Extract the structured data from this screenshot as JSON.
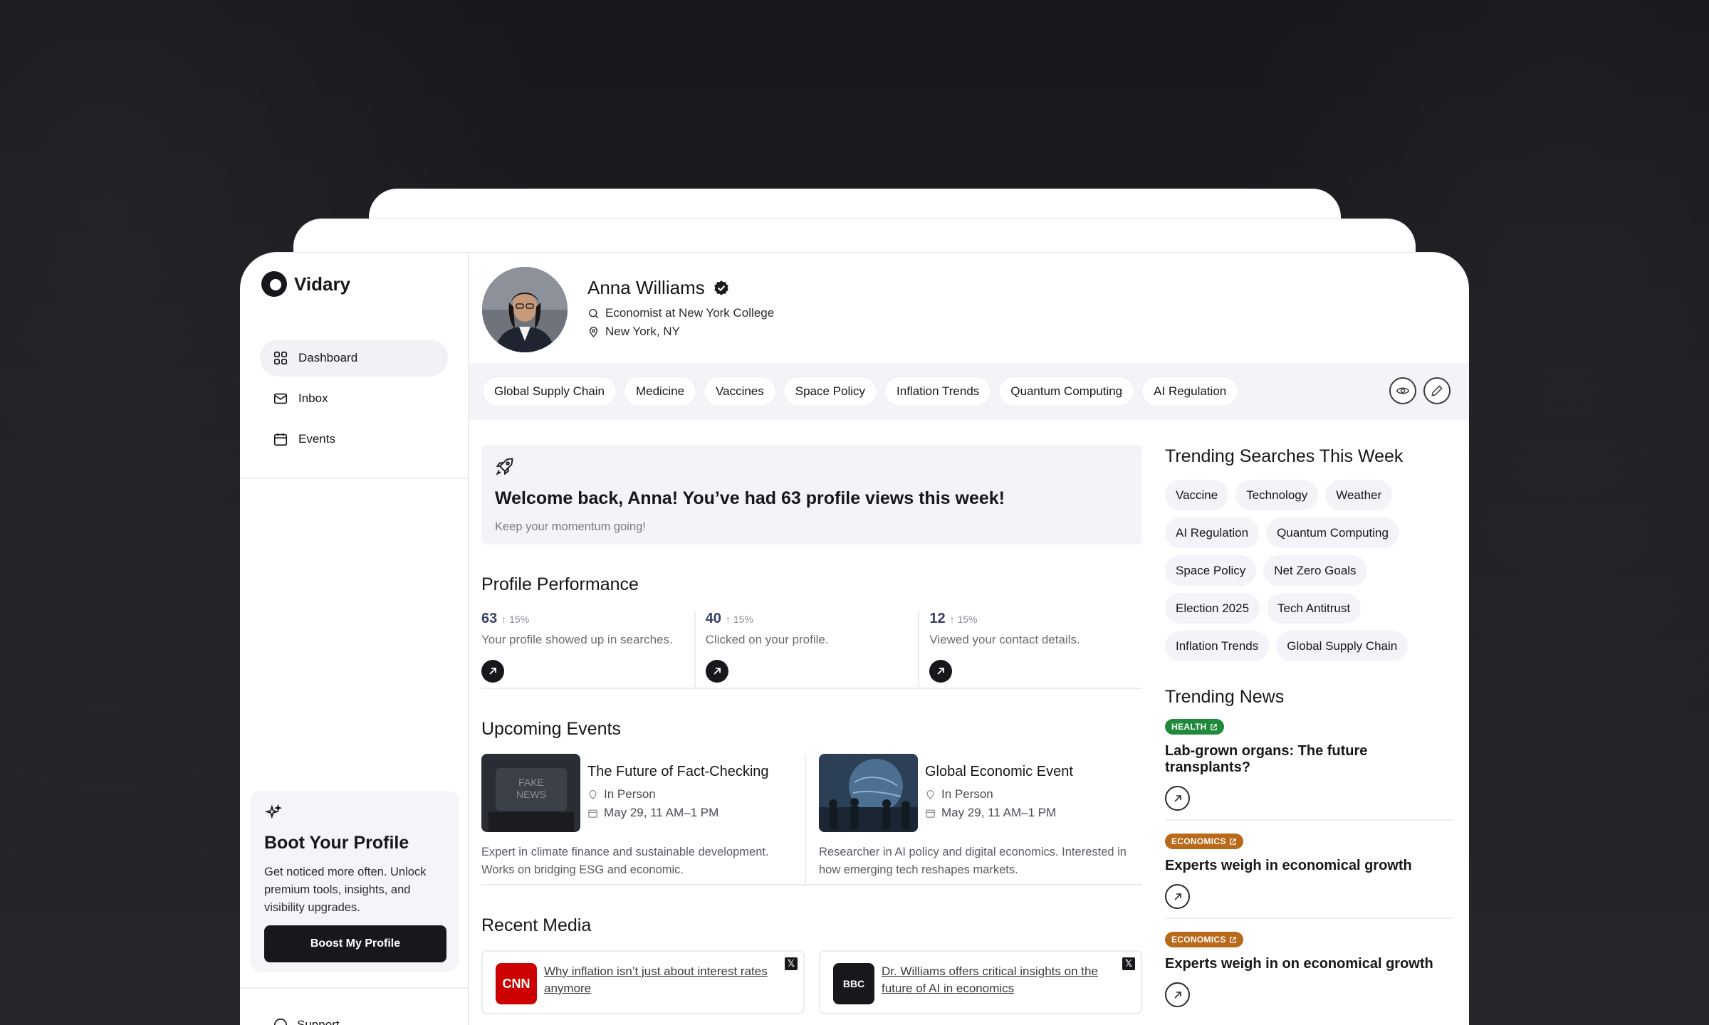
{
  "app": {
    "name": "Vidary"
  },
  "nav": [
    {
      "label": "Dashboard",
      "icon": "grid-icon",
      "active": true
    },
    {
      "label": "Inbox",
      "icon": "mail-icon",
      "active": false
    },
    {
      "label": "Events",
      "icon": "calendar-icon",
      "active": false
    }
  ],
  "promo": {
    "title": "Boot Your Profile",
    "text": "Get noticed more often. Unlock premium tools, insights, and visibility upgrades.",
    "button": "Boost My Profile"
  },
  "support": {
    "label": "Support"
  },
  "profile": {
    "name": "Anna Williams",
    "role": "Economist at New York College",
    "location": "New York, NY"
  },
  "tags": [
    "Global Supply Chain",
    "Medicine",
    "Vaccines",
    "Space Policy",
    "Inflation Trends",
    "Quantum Computing",
    "AI Regulation"
  ],
  "welcome": {
    "title": "Welcome back, Anna! You’ve had 63 profile views this week!",
    "subtitle": "Keep your momentum going!"
  },
  "performance": {
    "title": "Profile Performance",
    "items": [
      {
        "value": "63",
        "delta": "15%",
        "desc": "Your profile showed up in searches."
      },
      {
        "value": "40",
        "delta": "15%",
        "desc": "Clicked on your profile."
      },
      {
        "value": "12",
        "delta": "15%",
        "desc": "Viewed your contact details."
      }
    ]
  },
  "events": {
    "title": "Upcoming Events",
    "items": [
      {
        "title": "The Future of Fact-Checking",
        "mode": "In Person",
        "date": "May 29, 11 AM–1 PM",
        "desc": "Expert in climate finance and sustainable development. Works on bridging ESG and economic."
      },
      {
        "title": "Global Economic Event",
        "mode": "In Person",
        "date": "May 29, 11 AM–1 PM",
        "desc": "Researcher in AI policy and digital economics. Interested in how emerging tech reshapes markets."
      }
    ]
  },
  "media": {
    "title": "Recent Media",
    "items": [
      {
        "source": "CNN",
        "headline": "Why inflation isn’t just about interest rates anymore"
      },
      {
        "source": "BBC",
        "headline": "Dr. Williams offers critical insights on the future of AI in economics"
      }
    ]
  },
  "trending_searches": {
    "title": "Trending Searches This Week",
    "rows": [
      [
        "Vaccine",
        "Technology",
        "Weather"
      ],
      [
        "AI Regulation",
        "Quantum Computing"
      ],
      [
        "Space Policy",
        "Net Zero Goals"
      ],
      [
        "Election 2025",
        "Tech Antitrust"
      ],
      [
        "Inflation Trends",
        "Global Supply Chain"
      ]
    ]
  },
  "trending_news": {
    "title": "Trending News",
    "items": [
      {
        "category": "HEALTH",
        "color": "#1f8a3c",
        "headline": "Lab-grown organs: The future transplants?"
      },
      {
        "category": "ECONOMICS",
        "color": "#b8691a",
        "headline": "Experts weigh in economical growth"
      },
      {
        "category": "ECONOMICS",
        "color": "#b8691a",
        "headline": "Experts weigh in on economical growth"
      }
    ]
  }
}
